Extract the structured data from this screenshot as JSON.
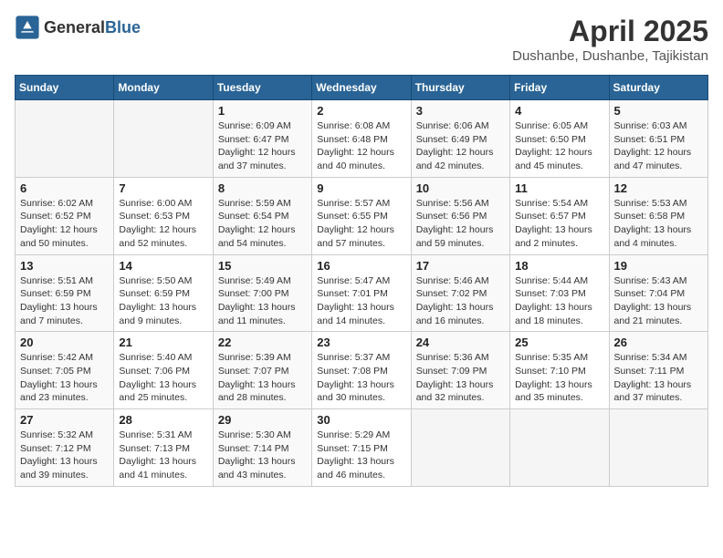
{
  "header": {
    "logo_general": "General",
    "logo_blue": "Blue",
    "title": "April 2025",
    "subtitle": "Dushanbe, Dushanbe, Tajikistan"
  },
  "calendar": {
    "weekdays": [
      "Sunday",
      "Monday",
      "Tuesday",
      "Wednesday",
      "Thursday",
      "Friday",
      "Saturday"
    ],
    "weeks": [
      [
        {
          "day": "",
          "info": ""
        },
        {
          "day": "",
          "info": ""
        },
        {
          "day": "1",
          "info": "Sunrise: 6:09 AM\nSunset: 6:47 PM\nDaylight: 12 hours\nand 37 minutes."
        },
        {
          "day": "2",
          "info": "Sunrise: 6:08 AM\nSunset: 6:48 PM\nDaylight: 12 hours\nand 40 minutes."
        },
        {
          "day": "3",
          "info": "Sunrise: 6:06 AM\nSunset: 6:49 PM\nDaylight: 12 hours\nand 42 minutes."
        },
        {
          "day": "4",
          "info": "Sunrise: 6:05 AM\nSunset: 6:50 PM\nDaylight: 12 hours\nand 45 minutes."
        },
        {
          "day": "5",
          "info": "Sunrise: 6:03 AM\nSunset: 6:51 PM\nDaylight: 12 hours\nand 47 minutes."
        }
      ],
      [
        {
          "day": "6",
          "info": "Sunrise: 6:02 AM\nSunset: 6:52 PM\nDaylight: 12 hours\nand 50 minutes."
        },
        {
          "day": "7",
          "info": "Sunrise: 6:00 AM\nSunset: 6:53 PM\nDaylight: 12 hours\nand 52 minutes."
        },
        {
          "day": "8",
          "info": "Sunrise: 5:59 AM\nSunset: 6:54 PM\nDaylight: 12 hours\nand 54 minutes."
        },
        {
          "day": "9",
          "info": "Sunrise: 5:57 AM\nSunset: 6:55 PM\nDaylight: 12 hours\nand 57 minutes."
        },
        {
          "day": "10",
          "info": "Sunrise: 5:56 AM\nSunset: 6:56 PM\nDaylight: 12 hours\nand 59 minutes."
        },
        {
          "day": "11",
          "info": "Sunrise: 5:54 AM\nSunset: 6:57 PM\nDaylight: 13 hours\nand 2 minutes."
        },
        {
          "day": "12",
          "info": "Sunrise: 5:53 AM\nSunset: 6:58 PM\nDaylight: 13 hours\nand 4 minutes."
        }
      ],
      [
        {
          "day": "13",
          "info": "Sunrise: 5:51 AM\nSunset: 6:59 PM\nDaylight: 13 hours\nand 7 minutes."
        },
        {
          "day": "14",
          "info": "Sunrise: 5:50 AM\nSunset: 6:59 PM\nDaylight: 13 hours\nand 9 minutes."
        },
        {
          "day": "15",
          "info": "Sunrise: 5:49 AM\nSunset: 7:00 PM\nDaylight: 13 hours\nand 11 minutes."
        },
        {
          "day": "16",
          "info": "Sunrise: 5:47 AM\nSunset: 7:01 PM\nDaylight: 13 hours\nand 14 minutes."
        },
        {
          "day": "17",
          "info": "Sunrise: 5:46 AM\nSunset: 7:02 PM\nDaylight: 13 hours\nand 16 minutes."
        },
        {
          "day": "18",
          "info": "Sunrise: 5:44 AM\nSunset: 7:03 PM\nDaylight: 13 hours\nand 18 minutes."
        },
        {
          "day": "19",
          "info": "Sunrise: 5:43 AM\nSunset: 7:04 PM\nDaylight: 13 hours\nand 21 minutes."
        }
      ],
      [
        {
          "day": "20",
          "info": "Sunrise: 5:42 AM\nSunset: 7:05 PM\nDaylight: 13 hours\nand 23 minutes."
        },
        {
          "day": "21",
          "info": "Sunrise: 5:40 AM\nSunset: 7:06 PM\nDaylight: 13 hours\nand 25 minutes."
        },
        {
          "day": "22",
          "info": "Sunrise: 5:39 AM\nSunset: 7:07 PM\nDaylight: 13 hours\nand 28 minutes."
        },
        {
          "day": "23",
          "info": "Sunrise: 5:37 AM\nSunset: 7:08 PM\nDaylight: 13 hours\nand 30 minutes."
        },
        {
          "day": "24",
          "info": "Sunrise: 5:36 AM\nSunset: 7:09 PM\nDaylight: 13 hours\nand 32 minutes."
        },
        {
          "day": "25",
          "info": "Sunrise: 5:35 AM\nSunset: 7:10 PM\nDaylight: 13 hours\nand 35 minutes."
        },
        {
          "day": "26",
          "info": "Sunrise: 5:34 AM\nSunset: 7:11 PM\nDaylight: 13 hours\nand 37 minutes."
        }
      ],
      [
        {
          "day": "27",
          "info": "Sunrise: 5:32 AM\nSunset: 7:12 PM\nDaylight: 13 hours\nand 39 minutes."
        },
        {
          "day": "28",
          "info": "Sunrise: 5:31 AM\nSunset: 7:13 PM\nDaylight: 13 hours\nand 41 minutes."
        },
        {
          "day": "29",
          "info": "Sunrise: 5:30 AM\nSunset: 7:14 PM\nDaylight: 13 hours\nand 43 minutes."
        },
        {
          "day": "30",
          "info": "Sunrise: 5:29 AM\nSunset: 7:15 PM\nDaylight: 13 hours\nand 46 minutes."
        },
        {
          "day": "",
          "info": ""
        },
        {
          "day": "",
          "info": ""
        },
        {
          "day": "",
          "info": ""
        }
      ]
    ]
  }
}
